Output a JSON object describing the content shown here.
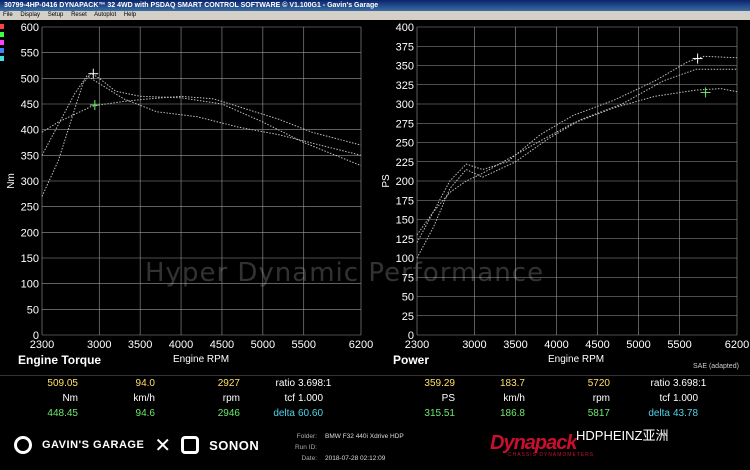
{
  "window": {
    "title": "30799-4HP-0416 DYNAPACK™ 32 4WD with PSDAQ SMART CONTROL SOFTWARE © V1.100G1 - Gavin's Garage"
  },
  "menu": [
    "File",
    "Display",
    "Setup",
    "Reset",
    "Autoplot",
    "Help"
  ],
  "colors": {
    "bg": "#000000",
    "grid": "#9a9a9a",
    "accent_yellow": "#ffe066",
    "accent_green": "#6de86d",
    "curve": "#bfbfbf"
  },
  "watermark": "Hyper Dynamic Performance",
  "chart_data": [
    {
      "type": "line",
      "title": "Engine Torque",
      "xlabel": "Engine RPM",
      "ylabel": "Nm",
      "xlim": [
        2300,
        6200
      ],
      "ylim": [
        0,
        600
      ],
      "xticks": [
        2300,
        3000,
        3500,
        4000,
        4500,
        5000,
        5500,
        6200
      ],
      "xtick_labels": [
        "2300",
        "3000",
        "3500",
        "4000",
        "4500",
        "5000",
        "5500",
        "6200"
      ],
      "yticks": [
        0,
        50,
        100,
        150,
        200,
        250,
        300,
        350,
        400,
        450,
        500,
        550,
        600
      ],
      "series": [
        {
          "values": [
            [
              2300,
              270
            ],
            [
              2500,
              340
            ],
            [
              2700,
              440
            ],
            [
              2800,
              490
            ],
            [
              2900,
              510
            ],
            [
              3000,
              500
            ],
            [
              3200,
              475
            ],
            [
              3500,
              465
            ],
            [
              4000,
              462
            ],
            [
              4500,
              450
            ],
            [
              5000,
              415
            ],
            [
              5500,
              375
            ],
            [
              6200,
              330
            ]
          ]
        },
        {
          "values": [
            [
              2300,
              395
            ],
            [
              2500,
              415
            ],
            [
              2700,
              430
            ],
            [
              2900,
              445
            ],
            [
              3000,
              448
            ],
            [
              3300,
              455
            ],
            [
              3600,
              460
            ],
            [
              4000,
              465
            ],
            [
              4400,
              460
            ],
            [
              4800,
              440
            ],
            [
              5200,
              420
            ],
            [
              5600,
              395
            ],
            [
              6200,
              370
            ]
          ]
        },
        {
          "values": [
            [
              2300,
              350
            ],
            [
              2500,
              410
            ],
            [
              2700,
              470
            ],
            [
              2850,
              505
            ],
            [
              3000,
              490
            ],
            [
              3300,
              460
            ],
            [
              3700,
              435
            ],
            [
              4200,
              425
            ],
            [
              4700,
              405
            ],
            [
              5200,
              390
            ],
            [
              5700,
              370
            ],
            [
              6200,
              350
            ]
          ]
        }
      ],
      "markers": [
        {
          "x": 2927,
          "y": 509,
          "color": "white"
        },
        {
          "x": 2946,
          "y": 448,
          "color": "green"
        }
      ]
    },
    {
      "type": "line",
      "title": "Power",
      "xlabel": "Engine RPM",
      "ylabel": "PS",
      "note": "SAE (adapted)",
      "xlim": [
        2300,
        6200
      ],
      "ylim": [
        0,
        400
      ],
      "xticks": [
        2300,
        3000,
        3500,
        4000,
        4500,
        5000,
        5500,
        6200
      ],
      "xtick_labels": [
        "2300",
        "3000",
        "3500",
        "4000",
        "4500",
        "5000",
        "5500",
        "6200"
      ],
      "yticks": [
        0,
        25,
        50,
        75,
        100,
        125,
        150,
        175,
        200,
        225,
        250,
        275,
        300,
        325,
        350,
        375,
        400
      ],
      "series": [
        {
          "values": [
            [
              2300,
              120
            ],
            [
              2500,
              160
            ],
            [
              2700,
              200
            ],
            [
              2900,
              222
            ],
            [
              3100,
              215
            ],
            [
              3400,
              225
            ],
            [
              3800,
              260
            ],
            [
              4200,
              285
            ],
            [
              4700,
              305
            ],
            [
              5200,
              330
            ],
            [
              5600,
              355
            ],
            [
              5800,
              362
            ],
            [
              6200,
              360
            ]
          ]
        },
        {
          "values": [
            [
              2300,
              130
            ],
            [
              2500,
              160
            ],
            [
              2700,
              185
            ],
            [
              2900,
              200
            ],
            [
              3100,
              210
            ],
            [
              3400,
              228
            ],
            [
              3800,
              252
            ],
            [
              4200,
              275
            ],
            [
              4700,
              295
            ],
            [
              5200,
              310
            ],
            [
              5700,
              318
            ],
            [
              6000,
              320
            ],
            [
              6200,
              316
            ]
          ]
        },
        {
          "values": [
            [
              2300,
              100
            ],
            [
              2500,
              140
            ],
            [
              2700,
              190
            ],
            [
              2900,
              215
            ],
            [
              3100,
              205
            ],
            [
              3500,
              225
            ],
            [
              3900,
              255
            ],
            [
              4300,
              280
            ],
            [
              4800,
              300
            ],
            [
              5300,
              330
            ],
            [
              5700,
              345
            ],
            [
              6200,
              345
            ]
          ]
        }
      ],
      "markers": [
        {
          "x": 5720,
          "y": 359,
          "color": "white"
        },
        {
          "x": 5817,
          "y": 315,
          "color": "green"
        }
      ]
    }
  ],
  "results": {
    "row1": {
      "torque": "509.05",
      "speed": "94.0",
      "rpm": "2927",
      "ratio_label": "ratio",
      "ratio": "3.698:1",
      "power": "359.29",
      "speed2": "183.7",
      "rpm2": "5720",
      "ratio_label2": "ratio",
      "ratio2": "3.698:1"
    },
    "row2": {
      "unit1": "Nm",
      "unit2": "km/h",
      "unit3": "rpm",
      "tcf_label": "tcf",
      "tcf": "1.000",
      "unit4": "PS",
      "unit5": "km/h",
      "unit6": "rpm",
      "tcf_label2": "tcf",
      "tcf2": "1.000"
    },
    "row3": {
      "torque": "448.45",
      "speed": "94.6",
      "rpm": "2946",
      "delta_label": "delta",
      "delta": "60.60",
      "power": "315.51",
      "speed2": "186.8",
      "rpm2": "5817",
      "delta_label2": "delta",
      "delta2": "43.78"
    }
  },
  "footer": {
    "brand1": "GAVIN'S GARAGE",
    "separator": "✕",
    "brand2": "SONON",
    "folder_label": "Folder:",
    "folder": "BMW F32 440i Xdrive HDP",
    "run_label": "Run ID:",
    "run": "",
    "date_label": "Date:",
    "date": "2018-07-28 02:12:09",
    "dyno": "Dynapack",
    "dyno_sub": "CHASSIS DYNAMOMETERS",
    "wechat": "HDPHEINZ亚洲"
  }
}
